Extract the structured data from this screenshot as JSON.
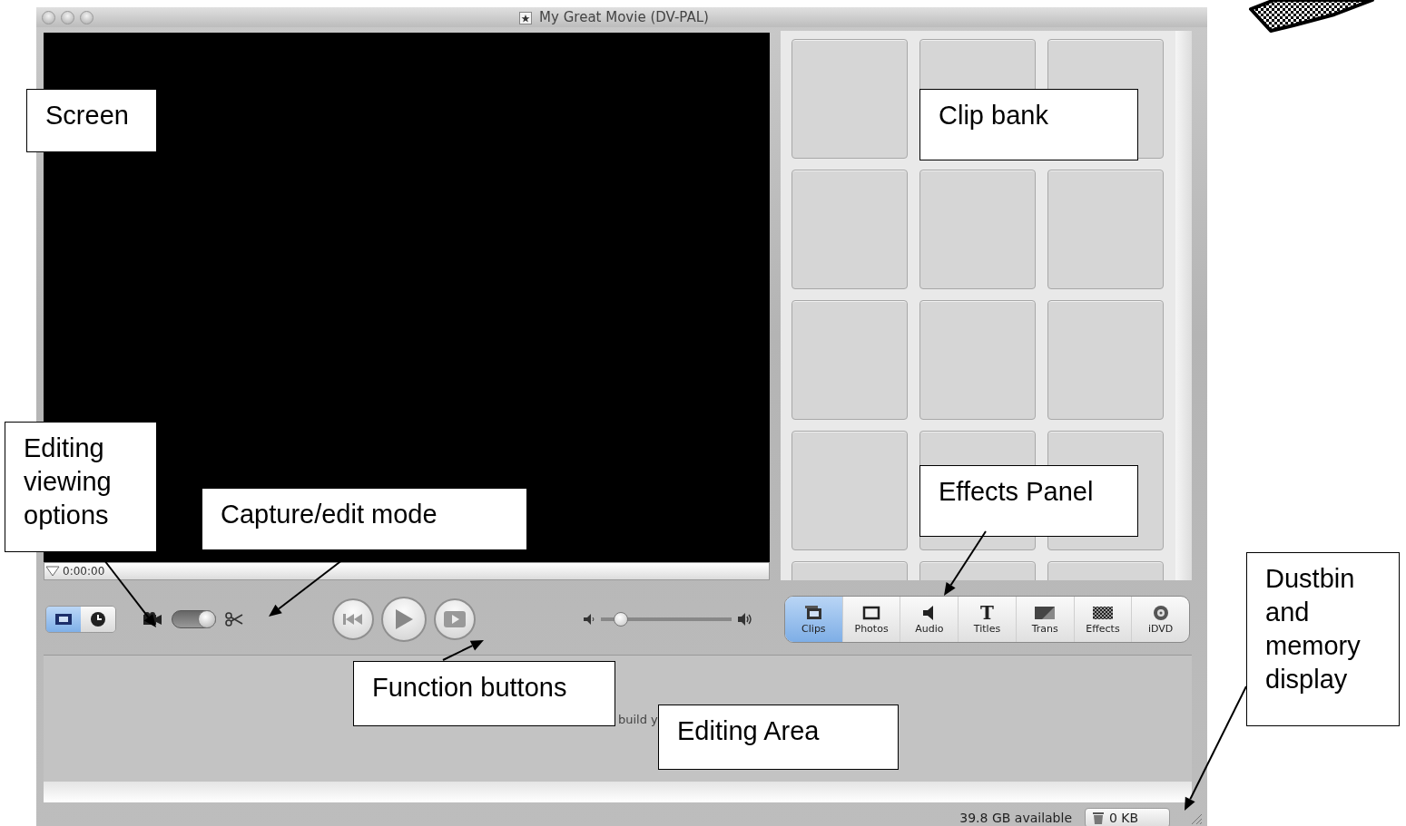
{
  "window": {
    "title": "My Great Movie (DV-PAL)"
  },
  "monitor": {
    "timecode": "0:00:00"
  },
  "view_toggle": [
    {
      "kind": "clip",
      "selected": true
    },
    {
      "kind": "time",
      "selected": false
    }
  ],
  "mode_switch": {
    "edit_mode": true
  },
  "volume": {
    "level": 0.15
  },
  "panel_tabs": [
    {
      "kind": "clips",
      "label": "Clips",
      "selected": true
    },
    {
      "kind": "photos",
      "label": "Photos",
      "selected": false
    },
    {
      "kind": "audio",
      "label": "Audio",
      "selected": false
    },
    {
      "kind": "titles",
      "label": "Titles",
      "glyph": "T",
      "selected": false
    },
    {
      "kind": "trans",
      "label": "Trans",
      "selected": false
    },
    {
      "kind": "effects",
      "label": "Effects",
      "selected": false
    },
    {
      "kind": "idvd",
      "label": "iDVD",
      "selected": false
    }
  ],
  "editing_area": {
    "hint": "build y"
  },
  "status_bar": {
    "space": "39.8 GB available",
    "trash": "0 KB"
  },
  "annotations": [
    {
      "text": "Screen"
    },
    {
      "text": "Clip bank"
    },
    {
      "text": "Editing viewing options"
    },
    {
      "text": "Capture/edit mode"
    },
    {
      "text": "Effects Panel"
    },
    {
      "text": "Function buttons"
    },
    {
      "text": "Editing Area"
    },
    {
      "text": "Dustbin and memory display"
    }
  ]
}
